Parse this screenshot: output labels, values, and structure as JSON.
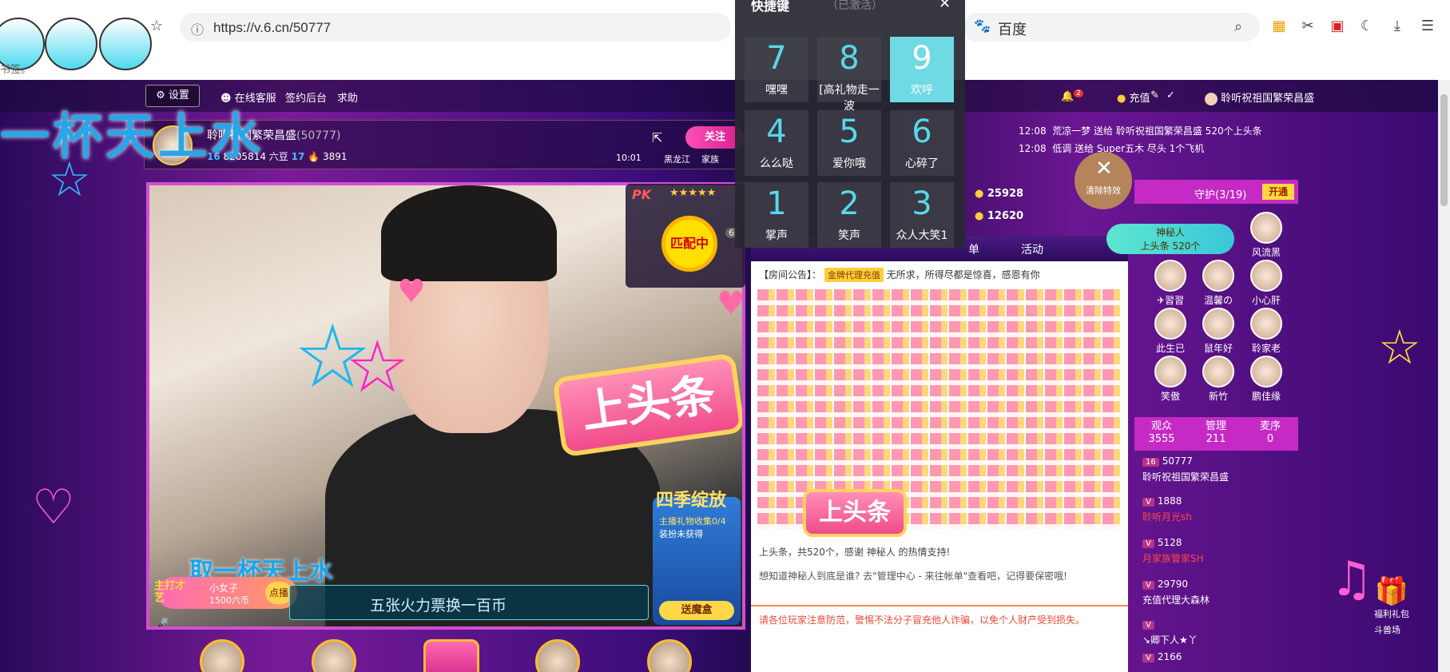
{
  "browser": {
    "url": "https://v.6.cn/50777",
    "search_placeholder": "百度",
    "bookmark_text": "书签。"
  },
  "nav": {
    "settings": "设置",
    "service": "在线客服",
    "signin": "签约后台",
    "help": "求助",
    "notif_count": "2",
    "recharge": "充值",
    "username": "聆听祝祖国繁荣昌盛"
  },
  "streamer": {
    "name": "聆听祖国繁荣昌盛",
    "room": "(50777)",
    "level": "16",
    "coins": "8205814 六豆",
    "level2": "17",
    "fire": "3891",
    "follow": "关注",
    "time": "10:01",
    "region": "黑龙江",
    "family": "家族"
  },
  "overlay_title": "一杯天上水",
  "video": {
    "banner": "上头条",
    "drink": "取一杯天上水",
    "ticker": "五张火力票换一百币",
    "chip_name": "小女子",
    "chip_coins": "1500六币",
    "chip_btn": "点播",
    "chip_tag": "主打才艺",
    "gift_title": "主播礼物收集0/4",
    "gift_sub": "装扮未获得",
    "gift_box": "送魔盒",
    "gift_header": "四季绽放"
  },
  "pk": {
    "label": "PK",
    "match": "匹配中",
    "count": "6"
  },
  "shortcut": {
    "title": "快捷键",
    "status": "（已激活）",
    "keys": [
      {
        "num": "7",
        "label": "嘿嘿"
      },
      {
        "num": "8",
        "label": "[高礼物走一波"
      },
      {
        "num": "9",
        "label": "欢呼"
      },
      {
        "num": "4",
        "label": "么么哒"
      },
      {
        "num": "5",
        "label": "爱你哦"
      },
      {
        "num": "6",
        "label": "心碎了"
      },
      {
        "num": "1",
        "label": "掌声"
      },
      {
        "num": "2",
        "label": "笑声"
      },
      {
        "num": "3",
        "label": "众人大笑1"
      }
    ]
  },
  "ticker_right": [
    {
      "time": "12:08",
      "text": "荒凉一梦 送给 聆听祝祖国繁荣昌盛 520个上头条"
    },
    {
      "time": "12:08",
      "text": "低调 送给 Super五木 尽头 1个飞机"
    }
  ],
  "clear_effects": "清除特效",
  "coins": {
    "a": "25928",
    "b": "12620"
  },
  "chat_tabs": [
    "单",
    "活动"
  ],
  "chat": {
    "announce_label": "【房间公告】：",
    "vip": "金牌代理充值",
    "announce": "无所求，所得尽都是惊喜，感恩有你",
    "banner": "上头条",
    "thanks": "上头条，共520个，感谢 神秘人 的热情支持!",
    "tip": "想知道神秘人到底是谁? 去\"管理中心 - 来往帐单\"查看吧，记得要保密哦!",
    "warn": "请各位玩家注意防范，警惕不法分子冒充他人诈骗，以免个人财产受到损失。"
  },
  "guard": {
    "title": "守护(3/19)",
    "open": "开通",
    "members": [
      "风流黑",
      "✈習習",
      "温馨の",
      "小心肝",
      "此生已",
      "鼠年好",
      "聆家老",
      "笑傲",
      "新竹",
      "鹏佳缘"
    ]
  },
  "mystery": {
    "name": "神秘人",
    "detail": "上头条 520个"
  },
  "audience": {
    "viewers_label": "观众",
    "viewers": "3555",
    "admin_label": "管理",
    "admin": "211",
    "queue_label": "麦序",
    "queue": "0",
    "list": [
      {
        "level": "16",
        "id": "50777",
        "name": "聆听祝祖国繁荣昌盛",
        "red": false
      },
      {
        "level": "V",
        "id": "1888",
        "name": "聆听月光sh",
        "red": true
      },
      {
        "level": "V",
        "id": "5128",
        "name": "月家族管家SH",
        "red": true
      },
      {
        "level": "V",
        "id": "29790",
        "name": "充值代理大森林",
        "red": false
      },
      {
        "level": "V",
        "id": "",
        "name": "↘卿下人★丫",
        "red": false
      },
      {
        "level": "V",
        "id": "2166",
        "name": "",
        "red": false
      }
    ]
  },
  "side": {
    "fuli": "福利礼包",
    "doushou": "斗兽场"
  }
}
